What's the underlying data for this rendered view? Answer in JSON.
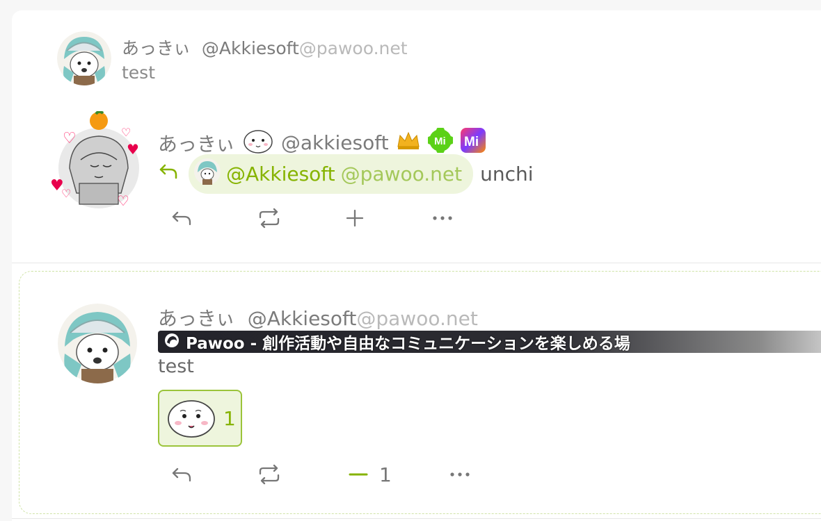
{
  "parent_note": {
    "display_name": "あっきぃ",
    "username": "@Akkiesoft",
    "host": "@pawoo.net",
    "text": "test"
  },
  "main_note": {
    "display_name": "あっきぃ",
    "username": "@akkiesoft",
    "badges": [
      "crown-icon",
      "misskey-green-icon",
      "misskey-gradient-icon"
    ],
    "reply_indicator_icon": "reply-arrow-icon",
    "mention_username": "@Akkiesoft",
    "mention_host": "@pawoo.net",
    "text": "unchi",
    "actions": [
      "reply-icon",
      "renote-icon",
      "plus-icon",
      "more-icon"
    ]
  },
  "quoted_note": {
    "display_name": "あっきぃ",
    "username": "@Akkiesoft",
    "host": "@pawoo.net",
    "instance_name": "Pawoo - 創作活動や自由なコミュニケーションを楽しめる場",
    "text": "test",
    "reaction_count": "1",
    "minus_count": "1",
    "actions": [
      "reply-icon",
      "renote-icon",
      "minus-icon",
      "more-icon"
    ]
  },
  "colors": {
    "accent": "#86b300",
    "mention_bg": "#eef5dd",
    "host_gray": "#b9b9b9"
  }
}
